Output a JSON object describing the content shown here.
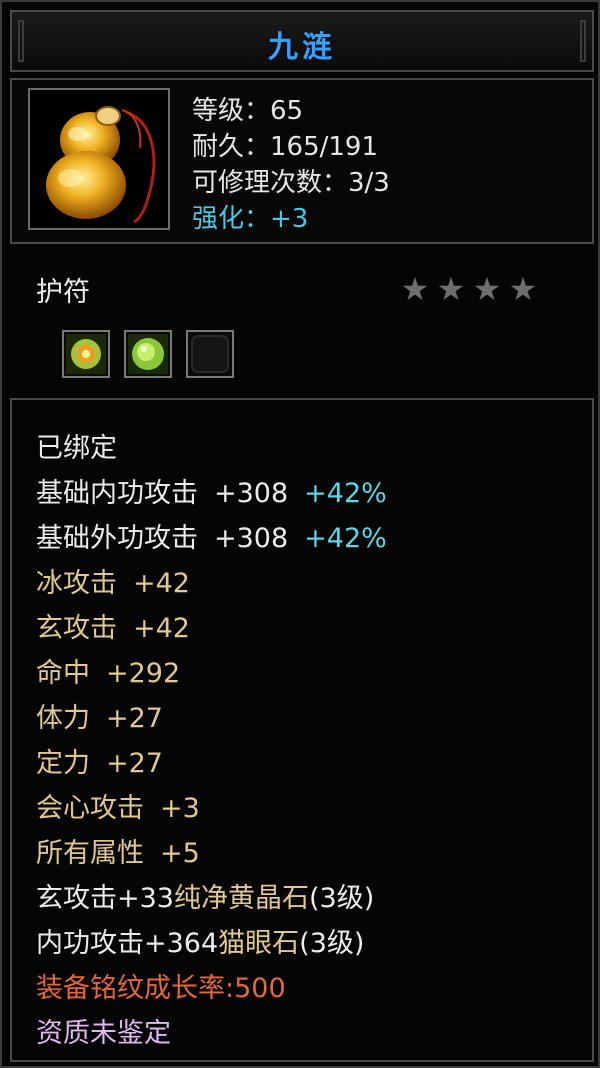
{
  "title": "九涟",
  "stats": {
    "level": "等级：65",
    "durability": "耐久：165/191",
    "repairs": "可修理次数：3/3",
    "enhance": "强化：+3"
  },
  "item_type": "护符",
  "star_count": 4,
  "icons": {
    "item": "gold-pendant-icon",
    "gem1": "gold-gem-icon",
    "gem2": "green-gem-icon",
    "gem3": "empty-slot-icon"
  },
  "lines": {
    "bound": "已绑定",
    "base_inner_label": "基础内功攻击",
    "base_inner_val": "+308",
    "base_inner_pct": "+42%",
    "base_outer_label": "基础外功攻击",
    "base_outer_val": "+308",
    "base_outer_pct": "+42%",
    "ice_label": "冰攻击",
    "ice_val": "+42",
    "xuan_label": "玄攻击",
    "xuan_val": "+42",
    "hit_label": "命中",
    "hit_val": "+292",
    "body_label": "体力",
    "body_val": "+27",
    "focus_label": "定力",
    "focus_val": "+27",
    "crit_label": "会心攻击",
    "crit_val": "+3",
    "all_label": "所有属性",
    "all_val": "+5",
    "gem_line1_prefix": "玄攻击+33",
    "gem_line1_name": "纯净黄晶石",
    "gem_line1_suffix": "(3级)",
    "gem_line2_prefix": "内功攻击+364",
    "gem_line2_name": "猫眼石",
    "gem_line2_suffix": "(3级)",
    "growth": "装备铭纹成长率:500",
    "quality": "资质未鉴定"
  },
  "colors": {
    "title": "#3aa0ff",
    "enhance": "#4cc8e0",
    "attr": "#e0c890",
    "bonus": "#5fd6e6",
    "growth": "#e06a3a",
    "quality": "#e0b8f0"
  }
}
